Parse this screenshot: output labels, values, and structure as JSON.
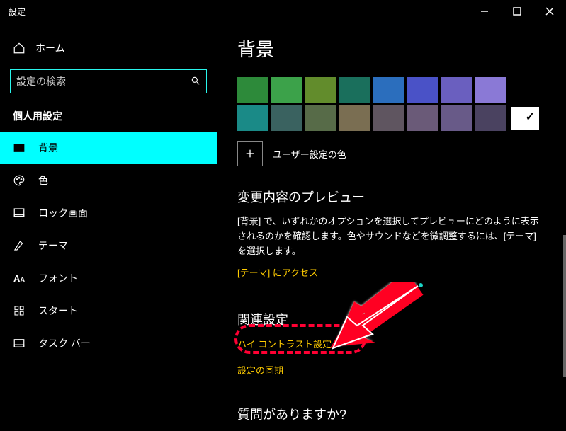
{
  "window": {
    "title": "設定"
  },
  "sidebar": {
    "home_label": "ホーム",
    "search_placeholder": "設定の検索",
    "section_label": "個人用設定",
    "items": [
      {
        "label": "背景",
        "icon": "picture-icon",
        "selected": true
      },
      {
        "label": "色",
        "icon": "palette-icon",
        "selected": false
      },
      {
        "label": "ロック画面",
        "icon": "lock-screen-icon",
        "selected": false
      },
      {
        "label": "テーマ",
        "icon": "theme-icon",
        "selected": false
      },
      {
        "label": "フォント",
        "icon": "font-icon",
        "selected": false
      },
      {
        "label": "スタート",
        "icon": "start-icon",
        "selected": false
      },
      {
        "label": "タスク バー",
        "icon": "taskbar-icon",
        "selected": false
      }
    ]
  },
  "main": {
    "heading": "背景",
    "swatches_row1": [
      "#2d8a3a",
      "#3ca24a",
      "#628c2c",
      "#1a6f5c",
      "#2b6ebd",
      "#4a52c7",
      "#6a5fbf",
      "#8a79d6"
    ],
    "swatches_row2": [
      "#1a8a87",
      "#3a6260",
      "#576b48",
      "#7a6e52",
      "#5f5560",
      "#6a5a78",
      "#685a88",
      "#4a4260",
      "#ffffff"
    ],
    "custom_color_label": "ユーザー設定の色",
    "preview_heading": "変更内容のプレビュー",
    "preview_desc": "[背景] で、いずれかのオプションを選択してプレビューにどのように表示されるのかを確認します。色やサウンドなどを微調整するには、[テーマ] を選択します。",
    "theme_link": "[テーマ] にアクセス",
    "related_heading": "関連設定",
    "related_links": [
      "ハイ コントラスト設定",
      "設定の同期"
    ],
    "question_heading": "質問がありますか?"
  }
}
